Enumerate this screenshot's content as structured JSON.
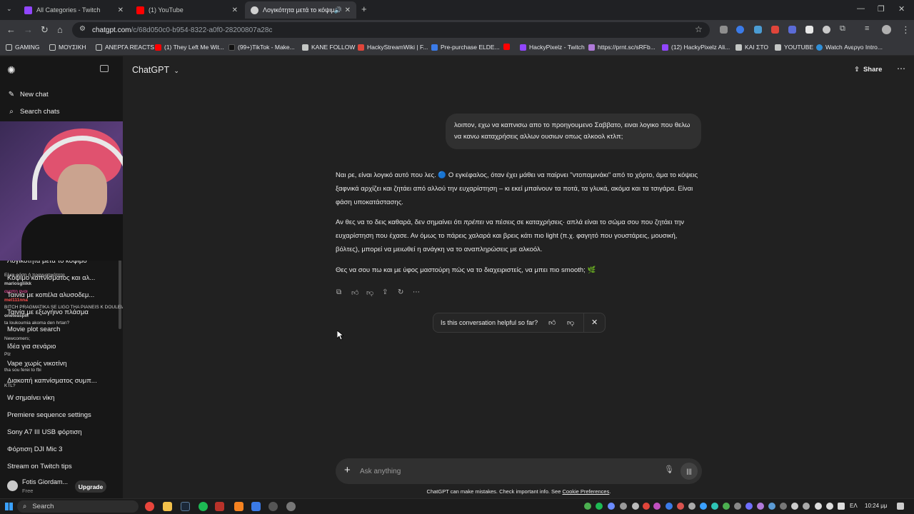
{
  "browser": {
    "tabs": [
      {
        "title": "All Categories - Twitch",
        "color": "#9146ff"
      },
      {
        "title": "(1) YouTube",
        "color": "#ff0000"
      },
      {
        "title": "Λογικότητα μετά το κόψιμ",
        "color": "#ffffff"
      }
    ],
    "url_host": "chatgpt.com",
    "url_path": "/c/68d050c0-b954-8322-a0f0-28200807a28c",
    "bookmarks": [
      "GAMING",
      "ΜΟΥΣΙΚΗ",
      "ΑΝΕΡΓΑ REACTS",
      "(1) They Left Me Wit...",
      "(99+)TikTok - Make...",
      "KANE FOLLOW",
      "HackyStreamWiki | F...",
      "Pre-purchase ELDE...",
      "HackyPixelz - Twitch",
      "https://prnt.sc/sRFb...",
      "(12) HackyPixelz Ali...",
      "ΚΑΙ ΣΤΟ",
      "YOUTUBE",
      "Watch Ανεργο Intro..."
    ]
  },
  "sidebar": {
    "new_chat": "New chat",
    "search_chats": "Search chats",
    "history": [
      "Λογικότητα μετά το κόψιμο",
      "Κόψιμο καπνίσματος και αλ...",
      "Ταινία με κοπέλα αλυσοδεμ...",
      "Ταινία με εξωγήινο πλάσμα",
      "Movie plot search",
      "Ιδέα για σενάριο",
      "Vape χωρίς νικοτίνη",
      "Διακοπή καπνίσματος συμπ...",
      "W σημαίνει νίκη",
      "Premiere sequence settings",
      "Sony A7 III USB φόρτιση",
      "Φόρτιση DJI Mic 3",
      "Stream on Twitch tips"
    ],
    "user_name": "Fotis Giordam...",
    "user_plan": "Free",
    "upgrade_label": "Upgrade"
  },
  "stream_chat": [
    {
      "user": "",
      "text": "Είναι φάση ή πραγματικότητα",
      "color": "#d0d0d0"
    },
    {
      "user": "mariosgliikk",
      "text": "αγαπη ηναι",
      "color": "#ff4da6"
    },
    {
      "user": "",
      "text": "BITCH PRAGMATIKA SE LIGO THA PIANEIS K DOULEIA",
      "color": "#d0d0d0"
    },
    {
      "user": "mel111nna",
      "text": "",
      "color": "#ff4d4d"
    },
    {
      "user": "oneteaspill",
      "text": "ta loukoumia akoma den hrtan?",
      "color": "#d0d0d0"
    },
    {
      "user": "",
      "text": "Newcomers;",
      "color": "#d0d0d0"
    },
    {
      "user": "",
      "text": "Plz",
      "color": "#d0d0d0"
    },
    {
      "user": "",
      "text": "tha sou ferei to fbi",
      "color": "#d0d0d0"
    },
    {
      "user": "",
      "text": "KTL?",
      "color": "#d0d0d0"
    }
  ],
  "header": {
    "model_label": "ChatGPT",
    "share_label": "Share"
  },
  "conversation": {
    "user_message": "λοιπον, εχω να καπνισω απο το προηγουμενο Σαββατο, ειναι λογικο που θελω να κανω καταχρήσεις αλλων ουσιων οπως αλκοολ κτλπ;",
    "assistant_p1": "Ναι ρε, είναι λογικό αυτό που λες. 🔵 Ο εγκέφαλος, όταν έχει μάθει να παίρνει \"ντοπαμινάκι\" από το χόρτο, άμα το κόψεις ξαφνικά αρχίζει και ζητάει από αλλού την ευχαρίστηση – κι εκεί μπαίνουν τα ποτά, τα γλυκά, ακόμα και τα τσιγάρα. Είναι φάση υποκατάστασης.",
    "assistant_p2_a": "Αν θες να το δεις καθαρά, δεν σημαίνει ότι ",
    "assistant_p2_em": "πρέπει",
    "assistant_p2_b": " να πέσεις σε καταχρήσεις· απλά είναι το σώμα σου που ζητάει την ευχαρίστηση που έχασε. Αν όμως το πάρεις χαλαρά και βρεις κάτι πιο light (π.χ. φαγητό που γουστάρεις, μουσική, βόλτες), μπορεί να μειωθεί η ανάγκη να το αναπληρώσεις με αλκοόλ.",
    "assistant_p3": "Θες να σου πω και με ύφος μαστούρη πώς να το διαχειριστείς, να μπει πιο smooth; 🌿",
    "feedback_question": "Is this conversation helpful so far?"
  },
  "composer": {
    "placeholder": "Ask anything"
  },
  "disclaimer": {
    "text": "ChatGPT can make mistakes. Check important info. See ",
    "link": "Cookie Preferences",
    "end": "."
  },
  "taskbar": {
    "search_label": "Search",
    "language": "ΕΛ",
    "time": "10:24 μμ"
  }
}
